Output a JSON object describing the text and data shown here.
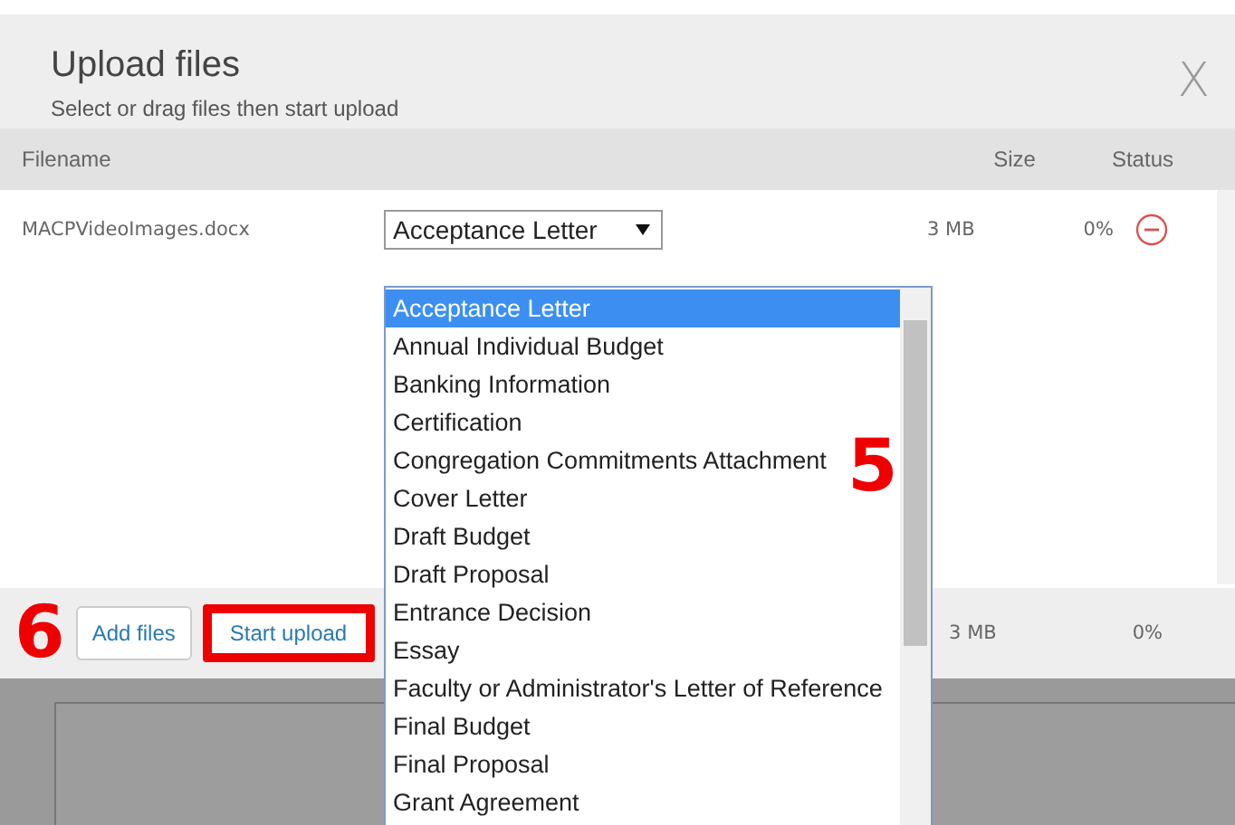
{
  "dialog": {
    "title": "Upload files",
    "subtitle": "Select or drag files then start upload",
    "close": "X"
  },
  "columns": [
    "Filename",
    "Size",
    "Status"
  ],
  "files": [
    {
      "filename": "MACPVideoImages.docx",
      "document_type": "Acceptance Letter",
      "size": "3 MB",
      "status": "0%"
    }
  ],
  "dropdown": {
    "options": [
      {
        "label": "Acceptance Letter",
        "selected": true
      },
      {
        "label": "Annual Individual Budget",
        "selected": false
      },
      {
        "label": "Banking Information",
        "selected": false
      },
      {
        "label": "Certification",
        "selected": false
      },
      {
        "label": "Congregation Commitments Attachment",
        "selected": false
      },
      {
        "label": "Cover Letter",
        "selected": false
      },
      {
        "label": "Draft Budget",
        "selected": false
      },
      {
        "label": "Draft Proposal",
        "selected": false
      },
      {
        "label": "Entrance Decision",
        "selected": false
      },
      {
        "label": "Essay",
        "selected": false
      },
      {
        "label": "Faculty or Administrator's Letter of Reference",
        "selected": false
      },
      {
        "label": "Final Budget",
        "selected": false
      },
      {
        "label": "Final Proposal",
        "selected": false
      },
      {
        "label": "Grant Agreement",
        "selected": false
      }
    ]
  },
  "footer": {
    "buttons": [
      {
        "label": "Add files",
        "highlighted": false
      },
      {
        "label": "Start upload",
        "highlighted": true
      }
    ],
    "total_size": "3 MB",
    "total_status": "0%"
  },
  "annotations": [
    "5",
    "6"
  ]
}
